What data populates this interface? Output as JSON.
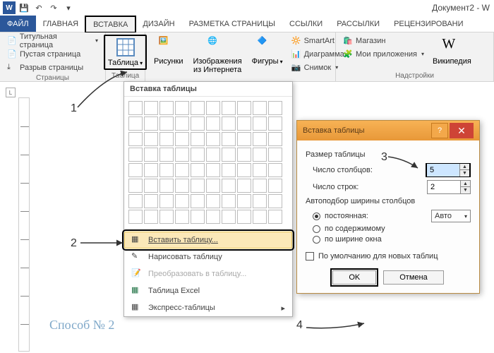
{
  "titlebar": {
    "doc_title": "Документ2 - W"
  },
  "tabs": {
    "file": "ФАЙЛ",
    "home": "ГЛАВНАЯ",
    "insert": "ВСТАВКА",
    "design": "ДИЗАЙН",
    "layout": "РАЗМЕТКА СТРАНИЦЫ",
    "refs": "ССЫЛКИ",
    "mail": "РАССЫЛКИ",
    "review": "РЕЦЕНЗИРОВАНИ"
  },
  "groups": {
    "pages": {
      "label": "Страницы",
      "title_page": "Титульная страница",
      "blank": "Пустая страница",
      "break": "Разрыв страницы"
    },
    "tables": {
      "label": "Таблица",
      "btn": "Таблица"
    },
    "illustrations": {
      "pictures": "Рисунки",
      "online_img": "Изображения\nиз Интернета",
      "shapes": "Фигуры",
      "smartart": "SmartArt",
      "chart": "Диаграмма",
      "screenshot": "Снимок"
    },
    "addins": {
      "label": "Надстройки",
      "store": "Магазин",
      "myapps": "Мои приложения",
      "wiki": "Википедия"
    }
  },
  "dropdown": {
    "title": "Вставка таблицы",
    "insert": "Вставить таблицу...",
    "draw": "Нарисовать таблицу",
    "convert": "Преобразовать в таблицу...",
    "excel": "Таблица Excel",
    "quick": "Экспресс-таблицы"
  },
  "dialog": {
    "title": "Вставка таблицы",
    "size_section": "Размер таблицы",
    "cols_label": "Число столбцов:",
    "cols_value": "5",
    "rows_label": "Число строк:",
    "rows_value": "2",
    "autofit_section": "Автоподбор ширины столбцов",
    "fixed": "постоянная:",
    "fixed_value": "Авто",
    "contents": "по содержимому",
    "window": "по ширине окна",
    "remember": "По умолчанию для новых таблиц",
    "ok": "OK",
    "cancel": "Отмена"
  },
  "annotations": {
    "n1": "1",
    "n2": "2",
    "n3": "3",
    "n4": "4",
    "method": "Способ № 2"
  }
}
